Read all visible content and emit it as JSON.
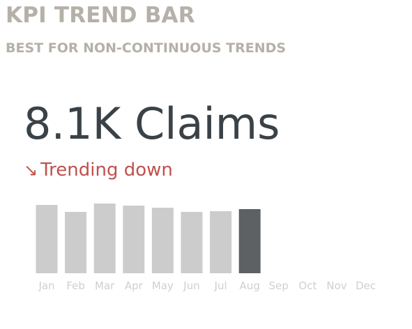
{
  "header": {
    "title": "KPI TREND BAR",
    "subtitle": "BEST FOR NON-CONTINUOUS TRENDS"
  },
  "kpi": {
    "value": "8.1K Claims",
    "trend_icon": "arrow-down-right-icon",
    "trend_arrow": "↘",
    "trend_text": "Trending down"
  },
  "colors": {
    "bar": "#cccccc",
    "bar_current": "#5d6163",
    "trend": "#c0504d",
    "value": "#3a4247",
    "title": "#b5b0a8",
    "tick": "#cfcfcf"
  },
  "chart_data": {
    "type": "bar",
    "categories": [
      "Jan",
      "Feb",
      "Mar",
      "Apr",
      "May",
      "Jun",
      "Jul",
      "Aug",
      "Sep",
      "Oct",
      "Nov",
      "Dec"
    ],
    "values": [
      9.8,
      8.8,
      10.0,
      9.7,
      9.4,
      8.8,
      8.9,
      9.2,
      null,
      null,
      null,
      null
    ],
    "highlight_index": 7,
    "ylim": [
      0,
      10.0
    ],
    "grid": false,
    "title": "",
    "xlabel": "",
    "ylabel": ""
  }
}
